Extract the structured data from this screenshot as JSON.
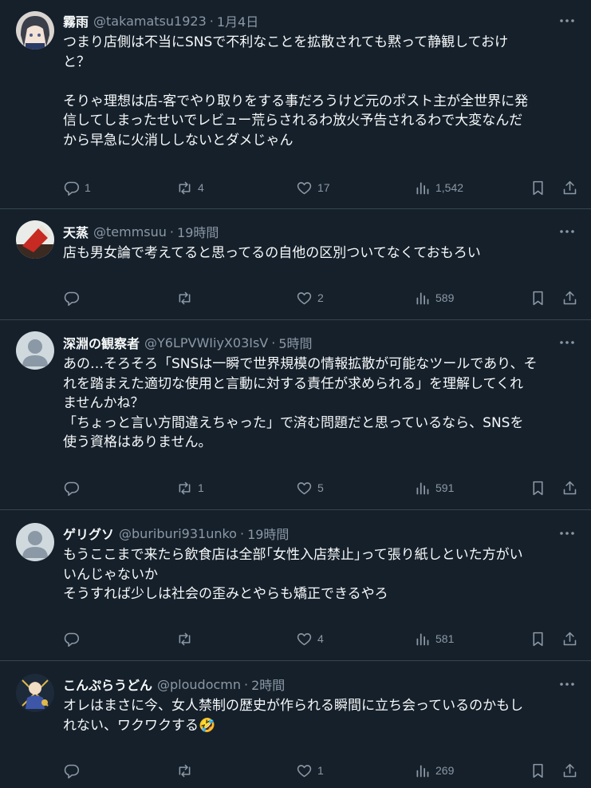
{
  "colors": {
    "background": "#15202b",
    "text": "#f7f9f9",
    "muted": "#8b98a5",
    "divider": "#38444d"
  },
  "tweets": [
    {
      "name": "霧雨",
      "handle": "@takamatsu1923",
      "time": "1月4日",
      "lines": [
        "つまり店側は不当にSNSで不利なことを拡散されても黙って静観しておけ",
        "と？",
        "",
        "そりゃ理想は店-客でやり取りをする事だろうけど元のポスト主が全世界に発",
        "信してしまったせいでレビュー荒らされるわ放火予告されるわで大変なんだ",
        "から早急に火消ししないとダメじゃん"
      ],
      "replies": "1",
      "reposts": "4",
      "likes": "17",
      "views": "1,542"
    },
    {
      "name": "天蒸",
      "handle": "@temmsuu",
      "time": "19時間",
      "lines": [
        "店も男女論で考えてると思ってるの自他の区別ついてなくておもろい"
      ],
      "replies": "",
      "reposts": "",
      "likes": "2",
      "views": "589"
    },
    {
      "name": "深淵の観察者",
      "handle": "@Y6LPVWIiyX03IsV",
      "time": "5時間",
      "lines": [
        "あの…そろそろ「SNSは一瞬で世界規模の情報拡散が可能なツールであり、そ",
        "れを踏まえた適切な使用と言動に対する責任が求められる」を理解してくれ",
        "ませんかね？",
        "「ちょっと言い方間違えちゃった」で済む問題だと思っているなら、SNSを",
        "使う資格はありません。"
      ],
      "replies": "",
      "reposts": "1",
      "likes": "5",
      "views": "591"
    },
    {
      "name": "ゲリグソ",
      "handle": "@buriburi931unko",
      "time": "19時間",
      "lines": [
        "もうここまで来たら飲食店は全部｢女性入店禁止｣って張り紙しといた方がい",
        "いんじゃないか",
        "そうすれば少しは社会の歪みとやらも矯正できるやろ"
      ],
      "replies": "",
      "reposts": "",
      "likes": "4",
      "views": "581"
    },
    {
      "name": "こんぷらうどん",
      "handle": "@ploudocmn",
      "time": "2時間",
      "lines": [
        "オレはまさに今、女人禁制の歴史が作られる瞬間に立ち会っているのかもし",
        "れない、ワクワクする🤣"
      ],
      "replies": "",
      "reposts": "",
      "likes": "1",
      "views": "269"
    }
  ],
  "icons": {
    "more": "more-icon",
    "reply": "reply-icon",
    "repost": "repost-icon",
    "like": "heart-icon",
    "views": "views-icon",
    "bookmark": "bookmark-icon",
    "share": "share-icon"
  }
}
